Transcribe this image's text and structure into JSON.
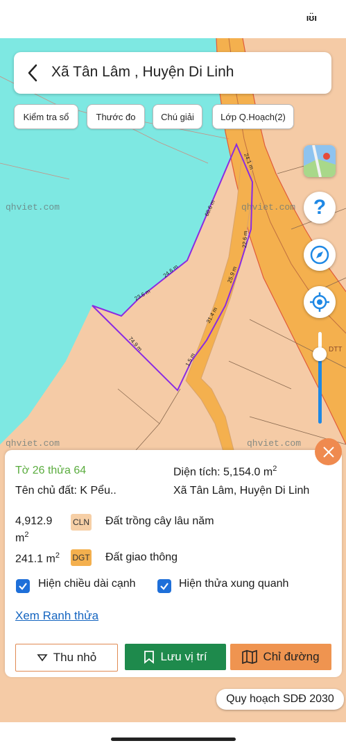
{
  "statusbar": {
    "indicator": "ıʊ̈ı"
  },
  "header": {
    "title": "Xã Tân Lâm , Huyện Di Linh"
  },
  "toolbar": {
    "check_book": "Kiểm tra sổ",
    "ruler": "Thước đo",
    "legend": "Chú giải",
    "planning_layer": "Lớp Q.Hoạch(2)"
  },
  "map": {
    "watermark": "qhviet.com",
    "edge_labels": [
      "24.1 m",
      "68.6 m",
      "22.6 m",
      "25.9 m",
      "24.6 m",
      "23.6 m",
      "31.4 m",
      "74.9 m",
      "1.5 m"
    ],
    "side_label": "DTT",
    "colors": {
      "water": "#7ee8e2",
      "land": "#f5cba6",
      "road": "#f4b04e",
      "parcel_boundary": "#8a2be2"
    }
  },
  "controls": {
    "zoom_level": 0.75
  },
  "panel": {
    "sheet_parcel": "Tờ 26 thửa 64",
    "area_label": "Diện tích: 5,154.0 m",
    "area_sup": "2",
    "owner": "Tên chủ đất: K Pểu..",
    "location": "Xã Tân Lâm, Huyện Di Linh",
    "land_uses": [
      {
        "area": "4,912.9",
        "unit": "m",
        "sup": "2",
        "code": "CLN",
        "name": "Đất trồng cây lâu năm",
        "color": "#f6cfa6"
      },
      {
        "area": "241.1 m",
        "sup": "2",
        "code": "DGT",
        "name": "Đất giao thông",
        "color": "#f4b04e"
      }
    ],
    "show_edge_length": {
      "label": "Hiện chiều dài cạnh",
      "checked": true
    },
    "show_neighbors": {
      "label": "Hiện thửa xung quanh",
      "checked": true
    },
    "view_boundary": "Xem Ranh thửa",
    "buttons": {
      "minimize": "Thu nhỏ",
      "save": "Lưu vị trí",
      "directions": "Chỉ đường"
    }
  },
  "footer": {
    "plan_label": "Quy hoạch SDĐ 2030"
  },
  "theme": {
    "green": "#1e8a4c",
    "orange": "#ef8a4f",
    "link": "#1565c0",
    "parcel_title": "#5aac3e"
  }
}
